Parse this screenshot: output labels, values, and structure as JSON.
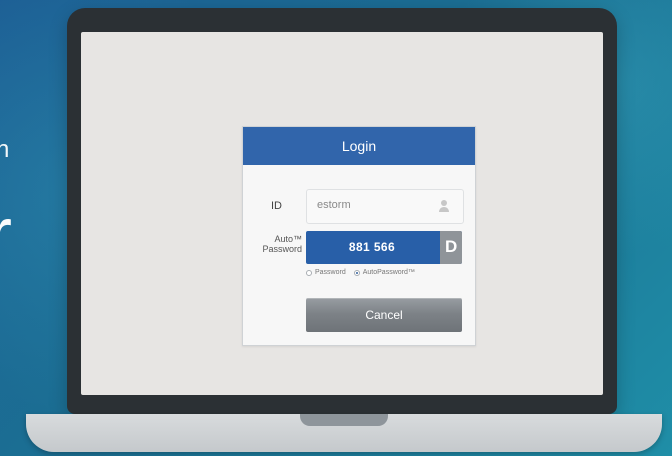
{
  "background": {
    "left_small_text": "n",
    "left_large_text": "r"
  },
  "login": {
    "title": "Login",
    "id_label": "ID",
    "id_value": "estorm",
    "auto_password_label_line1": "Auto™",
    "auto_password_label_line2": "Password",
    "auto_password_value": "881 566",
    "auto_password_badge": "D",
    "radio_password_label": "Password",
    "radio_autopassword_label": "AutoPassword™",
    "cancel_label": "Cancel"
  },
  "icons": {
    "user": "user-icon"
  },
  "colors": {
    "header_blue": "#3165ab",
    "auto_blue": "#285fa8",
    "button_gray": "#7d8287"
  }
}
